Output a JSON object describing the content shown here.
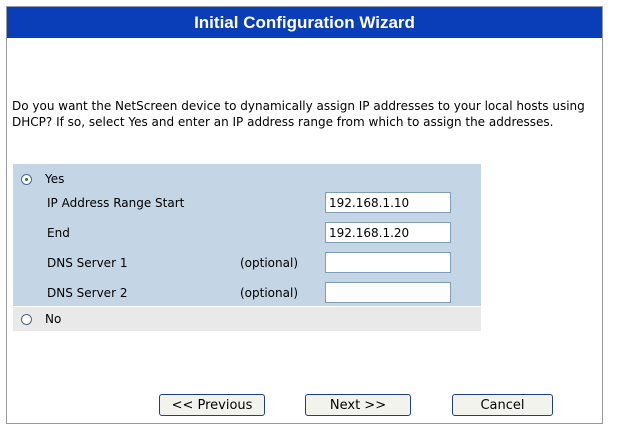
{
  "title": "Initial Configuration Wizard",
  "intro_text": "Do you want the NetScreen device to dynamically assign IP addresses to your local hosts using DHCP? If so, select Yes and enter an IP address range from which to assign the addresses.",
  "dhcp": {
    "yes_label": "Yes",
    "no_label": "No",
    "selected": "Yes",
    "range_start_label": "IP Address Range Start",
    "range_start_value": "192.168.1.10",
    "range_end_label": "End",
    "range_end_value": "192.168.1.20",
    "dns1_label": "DNS Server 1",
    "dns2_label": "DNS Server 2",
    "optional_label": "(optional)",
    "dns1_value": "",
    "dns2_value": ""
  },
  "buttons": {
    "previous": "<< Previous",
    "next": "Next >>",
    "cancel": "Cancel"
  },
  "colors": {
    "title_bar": "#0a3db8",
    "yes_panel": "#c4d5e6",
    "no_panel": "#e9e9e9"
  }
}
